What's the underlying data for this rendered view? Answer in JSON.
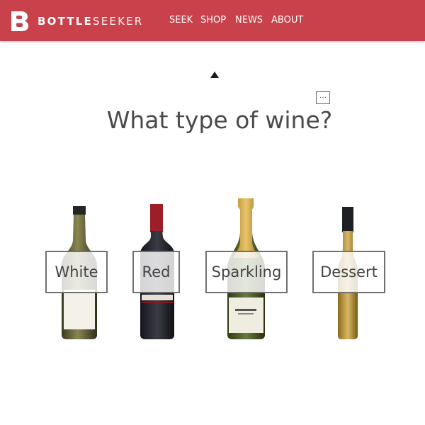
{
  "header": {
    "brand_bold": "BOTTLE",
    "brand_light": "SEEKER",
    "brand_color": "#c9414a",
    "nav": [
      "SEEK",
      "SHOP",
      "NEWS",
      "ABOUT"
    ]
  },
  "question": {
    "title": "What type of wine?",
    "more_icon": "···"
  },
  "options": [
    {
      "label": "White"
    },
    {
      "label": "Red"
    },
    {
      "label": "Sparkling"
    },
    {
      "label": "Dessert"
    }
  ],
  "icons": [
    "logo-b-icon",
    "caret-up-icon",
    "more-options-icon"
  ]
}
